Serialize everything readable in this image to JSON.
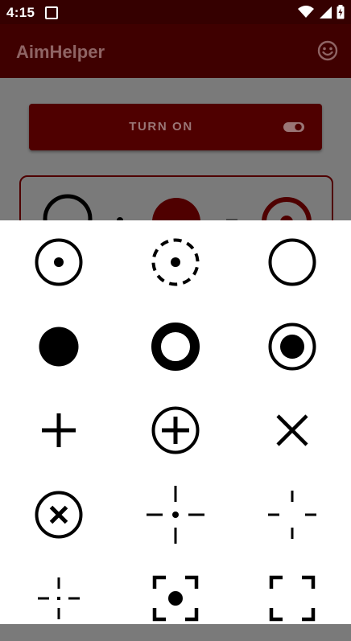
{
  "status_bar": {
    "time": "4:15",
    "icons": [
      "notification-icon",
      "wifi-icon",
      "signal-icon",
      "battery-icon"
    ]
  },
  "app_bar": {
    "title": "AimHelper",
    "action_icon": "smiley-icon"
  },
  "main": {
    "turn_on_label": "TURN ON",
    "toggle_icon": "toggle-icon"
  },
  "crosshair_sheet": {
    "options": [
      "dot-in-circle-crosshair",
      "dashed-circle-dot-crosshair",
      "hollow-circle-crosshair",
      "filled-dot-crosshair",
      "thick-ring-crosshair",
      "ringed-filled-dot-crosshair",
      "plus-crosshair",
      "circled-plus-crosshair",
      "cross-x-crosshair",
      "circled-x-crosshair",
      "gapped-cross-dot-crosshair",
      "gapped-cross-crosshair",
      "small-gapped-cross-dot-crosshair",
      "bracket-dot-crosshair",
      "bracket-frame-crosshair"
    ]
  },
  "colors": {
    "status_bar": "#350000",
    "app_bar": "#3f0000",
    "accent": "#4f0000",
    "scrim": "#7a7a7a",
    "sheet": "#ffffff",
    "icon": "#000000"
  }
}
